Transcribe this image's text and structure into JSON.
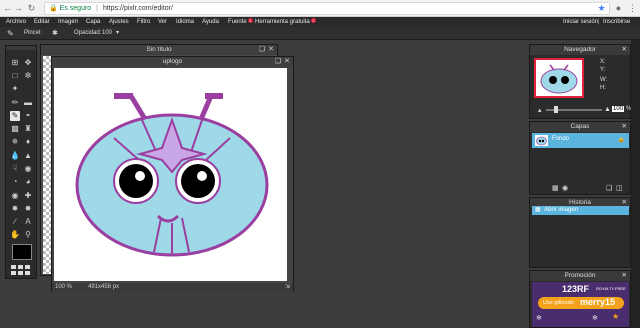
{
  "browser": {
    "secure_label": "Es seguro",
    "url": "https://pixlr.com/editor/"
  },
  "menu": {
    "items": [
      "Archivo",
      "Editar",
      "Imagen",
      "Capa",
      "Ajustes",
      "Filtro",
      "Ver",
      "Idioma",
      "Ayuda"
    ],
    "fuente": "Fuente",
    "herramienta": "Herramienta gratuita",
    "badge": "1",
    "login": "Iniciar sesión",
    "register": "Inscribirse"
  },
  "options": {
    "pencil_label": "Pincel:",
    "opacity_label": "Opacidad:",
    "opacity_value": "100"
  },
  "doc1": {
    "title": "Sin título"
  },
  "doc2": {
    "title": "uplogo",
    "zoom": "100 %",
    "size": "491x458 px"
  },
  "navigator": {
    "title": "Navegador",
    "x_label": "X:",
    "y_label": "Y:",
    "w_label": "W:",
    "h_label": "H:",
    "zoom": "100",
    "pct": "%"
  },
  "layers": {
    "title": "Capas",
    "layer_name": "Fondo"
  },
  "history": {
    "title": "Historia",
    "entry": "Abrir imagen"
  },
  "promo": {
    "title": "Promoción",
    "brand": "123RF",
    "brand_sub": "ROYALTY-FREE",
    "giftcode_label": "Use giftcode:",
    "giftcode": "merry15"
  },
  "colors": {
    "face_fill": "#9fd9e8",
    "face_stroke": "#9a3fa0",
    "inner_shape": "#c9a6e6",
    "promo_bg": "#4a2d6e",
    "promo_accent": "#f4a21a",
    "highlight": "#5ab4dd"
  }
}
